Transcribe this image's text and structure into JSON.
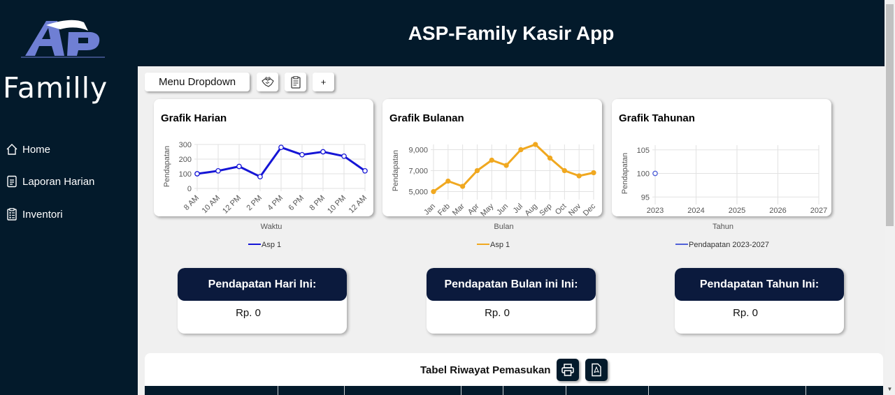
{
  "app": {
    "title": "ASP-Family Kasir App",
    "logo_mark": "ASP",
    "logo_word": "Familly"
  },
  "sidebar": {
    "items": [
      {
        "label": "Home",
        "icon": "home-icon"
      },
      {
        "label": "Laporan Harian",
        "icon": "document-icon"
      },
      {
        "label": "Inventori",
        "icon": "clipboard-icon"
      }
    ]
  },
  "toolbar": {
    "menu_label": "Menu Dropdown",
    "buttons": [
      {
        "icon": "handshake-icon"
      },
      {
        "icon": "clipboard-list-icon"
      },
      {
        "label": "+"
      }
    ]
  },
  "charts": [
    {
      "title": "Grafik Harian",
      "legend": "Asp 1"
    },
    {
      "title": "Grafik Bulanan",
      "legend": "Asp 1"
    },
    {
      "title": "Grafik Tahunan",
      "legend": "Pendapatan 2023-2027"
    }
  ],
  "chart_data": [
    {
      "type": "line",
      "title": "Grafik Harian",
      "xlabel": "Waktu",
      "ylabel": "Pendapatan",
      "categories": [
        "8 AM",
        "10 AM",
        "12 PM",
        "2 PM",
        "4 PM",
        "6 PM",
        "8 PM",
        "10 PM",
        "12 AM"
      ],
      "yticks": [
        "0",
        "100",
        "200",
        "300"
      ],
      "ylim": [
        0,
        300
      ],
      "series": [
        {
          "name": "Asp 1",
          "values": [
            100,
            120,
            150,
            80,
            280,
            230,
            250,
            220,
            120
          ]
        }
      ],
      "color": "#1515d6",
      "grid": true,
      "legend": "bottom"
    },
    {
      "type": "line",
      "title": "Grafik Bulanan",
      "xlabel": "Bulan",
      "ylabel": "Pendapatan",
      "categories": [
        "Jan",
        "Feb",
        "Mar",
        "Apr",
        "May",
        "Jun",
        "Jul",
        "Aug",
        "Sep",
        "Oct",
        "Nov",
        "Dec"
      ],
      "yticks": [
        "5,000",
        "7,000",
        "9,000"
      ],
      "ylim": [
        4500,
        9500
      ],
      "series": [
        {
          "name": "Asp 1",
          "values": [
            5000,
            6000,
            5500,
            7000,
            8000,
            7500,
            9000,
            9500,
            8200,
            7000,
            6500,
            6800
          ]
        }
      ],
      "color": "#f0a820",
      "grid": true,
      "legend": "bottom"
    },
    {
      "type": "line",
      "title": "Grafik Tahunan",
      "xlabel": "Tahun",
      "ylabel": "Pendapatan",
      "categories": [
        "2023",
        "2024",
        "2025",
        "2026",
        "2027"
      ],
      "yticks": [
        "95",
        "100",
        "105"
      ],
      "ylim": [
        94,
        106
      ],
      "series": [
        {
          "name": "Pendapatan 2023-2027",
          "values": [
            100,
            null,
            null,
            null,
            null
          ]
        }
      ],
      "color": "#5060d8",
      "grid": true,
      "legend": "bottom"
    }
  ],
  "stats": [
    {
      "label": "Pendapatan Hari Ini:",
      "value": "Rp. 0"
    },
    {
      "label": "Pendapatan Bulan ini Ini:",
      "value": "Rp. 0"
    },
    {
      "label": "Pendapatan Tahun Ini:",
      "value": "Rp. 0"
    }
  ],
  "table": {
    "title": "Tabel Riwayat Pemasukan",
    "buttons": [
      {
        "icon": "printer-icon"
      },
      {
        "icon": "pdf-icon"
      }
    ]
  }
}
